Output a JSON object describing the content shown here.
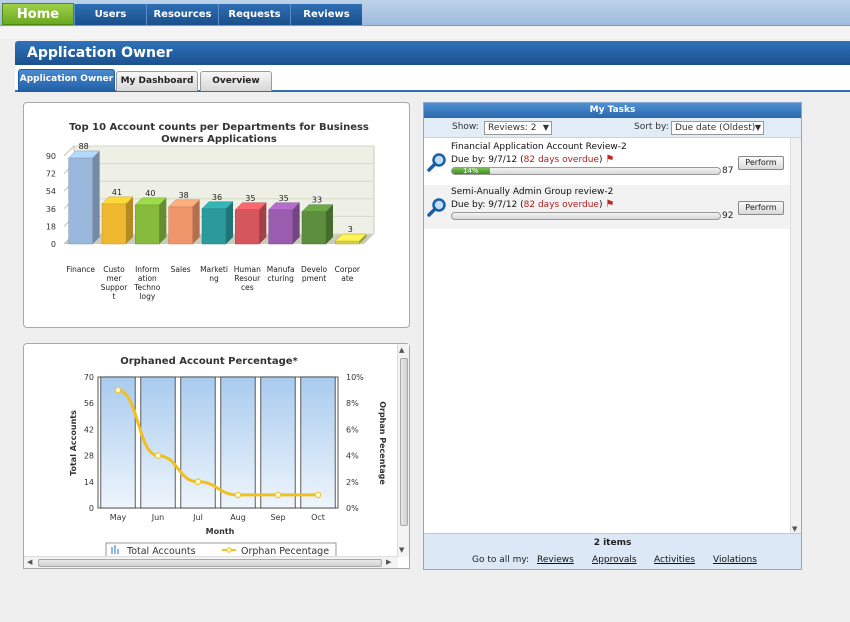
{
  "nav": {
    "home": "Home",
    "items": [
      "Users",
      "Resources",
      "Requests",
      "Reviews"
    ]
  },
  "page": {
    "title": "Application Owner"
  },
  "tabs": [
    "Application Owner",
    "My Dashboard",
    "Overview"
  ],
  "chart_data": [
    {
      "type": "bar",
      "title": "Top 10 Account counts per Departments for Business Owners Applications",
      "categories": [
        "Finance",
        "Customer Support",
        "Information Technology",
        "Sales",
        "Marketing",
        "Human Resources",
        "Manufacturing",
        "Development",
        "Corporate"
      ],
      "tick_labels": [
        "Finance",
        "Custo\nmer\nSuppor\nt",
        "Inform\nation\nTechno\nlogy",
        "Sales",
        "Marketi\nng",
        "Human\nResour\nces",
        "Manufa\ncturing",
        "Develo\npment",
        "Corpor\nate"
      ],
      "values": [
        88,
        41,
        40,
        38,
        36,
        35,
        35,
        33,
        3
      ],
      "colors": [
        "#9ab8dc",
        "#f0b830",
        "#86bb3e",
        "#f0946a",
        "#2a9a9c",
        "#d6565e",
        "#9a5cae",
        "#5c8e3e",
        "#d7cf48"
      ],
      "ylim": [
        0,
        90
      ],
      "yticks": [
        0,
        18,
        36,
        54,
        72,
        90
      ],
      "grid": true,
      "legend": "none"
    },
    {
      "type": "bar",
      "title": "Orphaned Account Percentage*",
      "categories": [
        "May",
        "Jun",
        "Jul",
        "Aug",
        "Sep",
        "Oct"
      ],
      "xlabel": "Month",
      "ylabel": "Total Accounts",
      "y2label": "Orphan Pecentage",
      "ylim": [
        0,
        70
      ],
      "yticks": [
        0,
        14,
        28,
        42,
        56,
        70
      ],
      "y2lim": [
        0,
        10
      ],
      "y2ticks": [
        "0%",
        "2%",
        "4%",
        "6%",
        "8%",
        "10%"
      ],
      "series": [
        {
          "name": "Total Accounts",
          "type": "bar",
          "values": [
            70,
            70,
            70,
            70,
            70,
            70
          ],
          "color": "#c8def5"
        },
        {
          "name": "Orphan Pecentage",
          "type": "line",
          "axis": "y2",
          "values": [
            9.0,
            4.0,
            2.0,
            1.0,
            1.0,
            1.0
          ],
          "color": "#f0c020"
        }
      ],
      "legend": "bottom"
    }
  ],
  "tasks": {
    "header": "My Tasks",
    "show_label": "Show:",
    "show_value": "Reviews: 2",
    "sort_label": "Sort by:",
    "sort_value": "Due date (Oldest)",
    "items": [
      {
        "title": "Financial Application Account Review-2",
        "due_prefix": "Due by: 9/7/12 (",
        "overdue": "82 days overdue",
        "due_suffix": ")",
        "progress": 14,
        "progress_label": "14%",
        "count": "87",
        "button": "Perform"
      },
      {
        "title": "Semi-Anually Admin Group review-2",
        "due_prefix": "Due by: 9/7/12 (",
        "overdue": "82 days overdue",
        "due_suffix": ")",
        "progress": 0,
        "progress_label": "",
        "count": "92",
        "button": "Perform"
      }
    ],
    "count_text": "2 items",
    "goto_label": "Go to all my:",
    "links": [
      "Reviews",
      "Approvals",
      "Activities",
      "Violations"
    ]
  }
}
